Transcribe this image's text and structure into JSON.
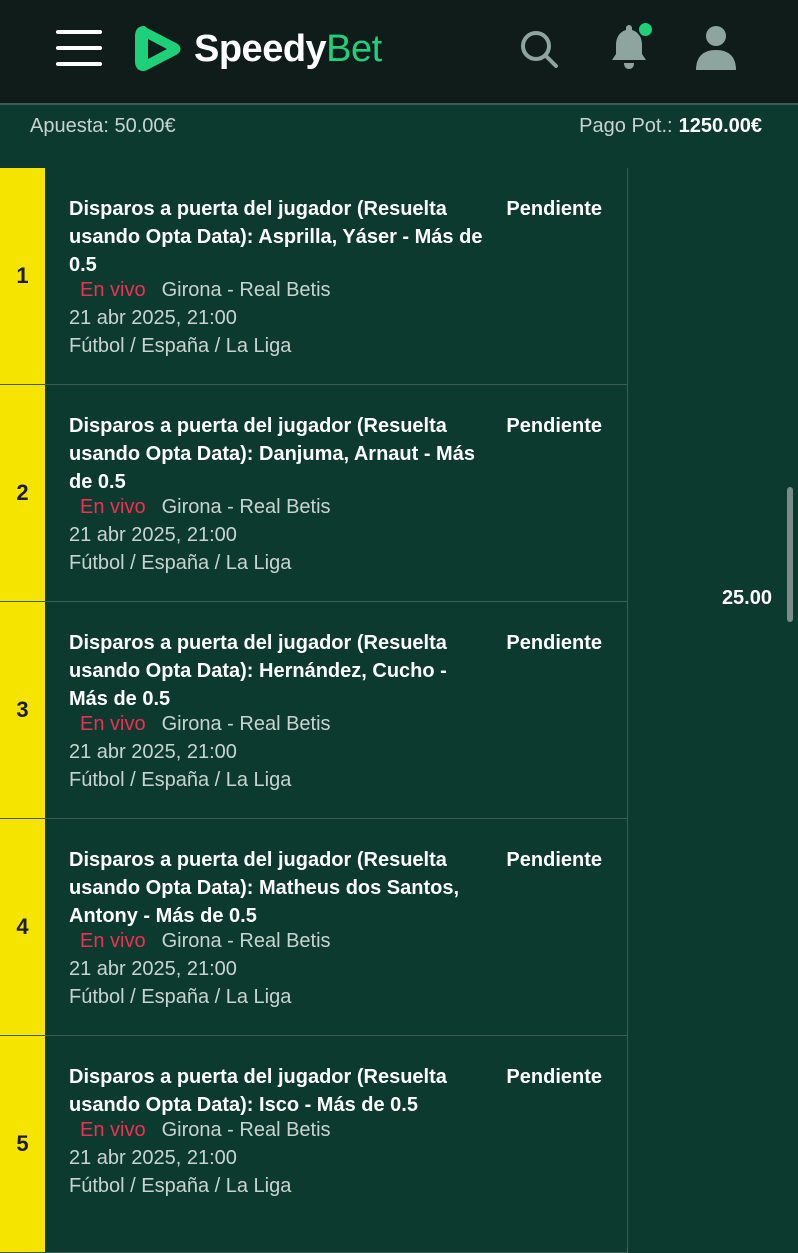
{
  "header": {
    "brand_primary": "Speedy",
    "brand_secondary": "Bet",
    "brand_color": "#1fd07a",
    "icons": [
      "menu-icon",
      "search-icon",
      "bell-icon",
      "user-icon"
    ]
  },
  "summary": {
    "stake_label": "Apuesta: 50.00€",
    "payout_label": "Pago Pot.:",
    "payout_value": "1250.00€"
  },
  "bets": [
    {
      "number": "1",
      "title": "Disparos a puerta del jugador (Resuelta usando Opta Data): Asprilla, Yáser - Más de 0.5",
      "status": "Pendiente",
      "live": "En vivo",
      "match": "Girona - Real Betis",
      "datetime": "21 abr 2025, 21:00",
      "competition": "Fútbol / España / La Liga"
    },
    {
      "number": "2",
      "title": "Disparos a puerta del jugador (Resuelta usando Opta Data): Danjuma, Arnaut - Más de 0.5",
      "status": "Pendiente",
      "live": "En vivo",
      "match": "Girona - Real Betis",
      "datetime": "21 abr 2025, 21:00",
      "competition": "Fútbol / España / La Liga"
    },
    {
      "number": "3",
      "title": "Disparos a puerta del jugador (Resuelta usando Opta Data): Hernández, Cucho - Más de 0.5",
      "status": "Pendiente",
      "live": "En vivo",
      "match": "Girona - Real Betis",
      "datetime": "21 abr 2025, 21:00",
      "competition": "Fútbol / España / La Liga"
    },
    {
      "number": "4",
      "title": "Disparos a puerta del jugador (Resuelta usando Opta Data): Matheus dos Santos, Antony - Más de 0.5",
      "status": "Pendiente",
      "live": "En vivo",
      "match": "Girona - Real Betis",
      "datetime": "21 abr 2025, 21:00",
      "competition": "Fútbol / España / La Liga"
    },
    {
      "number": "5",
      "title": "Disparos a puerta del jugador (Resuelta usando Opta Data): Isco - Más de 0.5",
      "status": "Pendiente",
      "live": "En vivo",
      "match": "Girona - Real Betis",
      "datetime": "21 abr 2025, 21:00",
      "competition": "Fútbol / España / La Liga"
    }
  ],
  "total_odds": "25.00"
}
